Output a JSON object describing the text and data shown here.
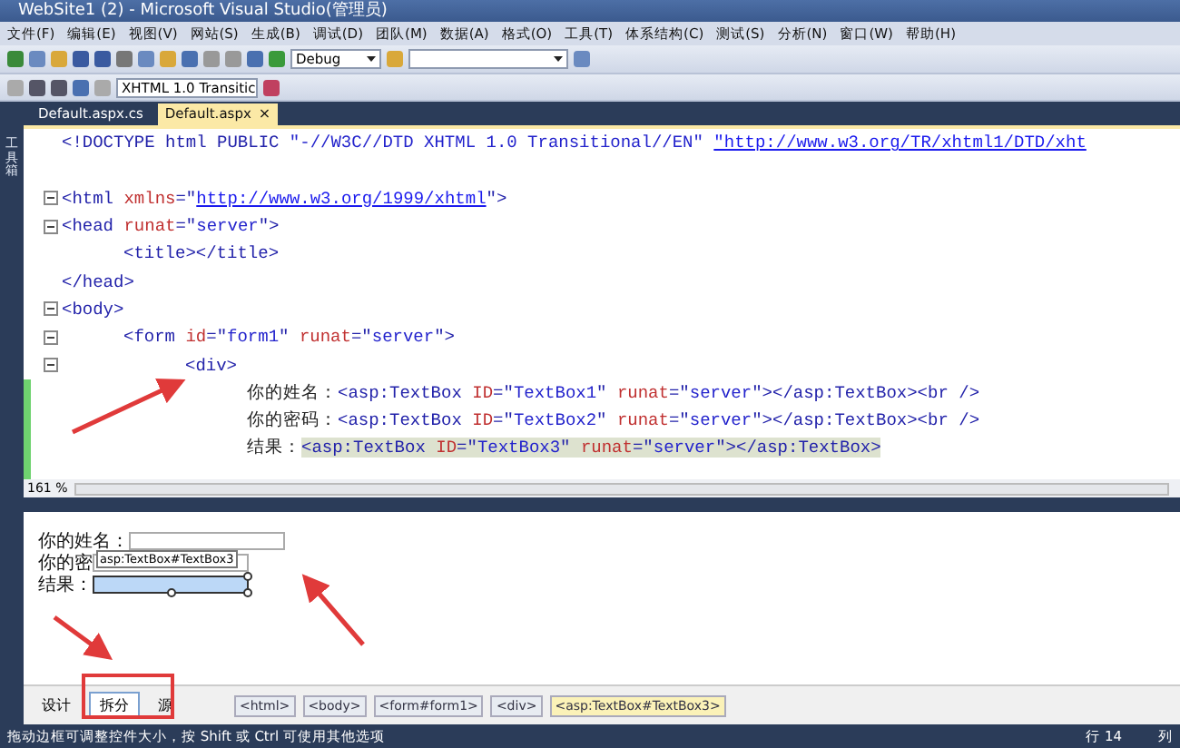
{
  "window": {
    "title": "WebSite1 (2) - Microsoft Visual Studio(管理员)"
  },
  "menu": [
    "文件(F)",
    "编辑(E)",
    "视图(V)",
    "网站(S)",
    "生成(B)",
    "调试(D)",
    "团队(M)",
    "数据(A)",
    "格式(O)",
    "工具(T)",
    "体系结构(C)",
    "测试(S)",
    "分析(N)",
    "窗口(W)",
    "帮助(H)"
  ],
  "toolbar": {
    "configuration": "Debug",
    "doctype": "XHTML 1.0 Transitic"
  },
  "sidebar": {
    "label": "工具箱"
  },
  "tabs": [
    {
      "label": "Default.aspx.cs",
      "selected": false
    },
    {
      "label": "Default.aspx",
      "selected": true,
      "close": "×"
    }
  ],
  "code_lines": [
    {
      "fold": false,
      "changed": false,
      "tokens": [
        {
          "kind": "tag",
          "text": "<!DOCTYPE html PUBLIC "
        },
        {
          "kind": "value",
          "text": "\"-//W3C//DTD XHTML 1.0 Transitional//EN\" "
        },
        {
          "kind": "link",
          "text": "\"http://www.w3.org/TR/xhtml1/DTD/xht"
        }
      ]
    },
    {
      "fold": false,
      "changed": false
    },
    {
      "fold": true,
      "changed": false,
      "tokens": [
        {
          "kind": "tag",
          "text": "<html "
        },
        {
          "kind": "attr",
          "text": "xmlns"
        },
        {
          "kind": "tag",
          "text": "=\""
        },
        {
          "kind": "link",
          "text": "http://www.w3.org/1999/xhtml"
        },
        {
          "kind": "tag",
          "text": "\">"
        }
      ]
    },
    {
      "fold": true,
      "changed": false,
      "tokens": [
        {
          "kind": "tag",
          "text": "<head "
        },
        {
          "kind": "attr",
          "text": "runat"
        },
        {
          "kind": "tag",
          "text": "=\""
        },
        {
          "kind": "value",
          "text": "server"
        },
        {
          "kind": "tag",
          "text": "\">"
        }
      ],
      "children": [
        {
          "fold": false,
          "changed": false,
          "tokens": [
            {
              "kind": "tag",
              "text": "<title></title>"
            }
          ]
        }
      ]
    },
    {
      "fold": false,
      "changed": false,
      "tokens": [
        {
          "kind": "tag",
          "text": "</head>"
        }
      ]
    },
    {
      "fold": true,
      "changed": false,
      "tokens": [
        {
          "kind": "tag",
          "text": "<body>"
        }
      ],
      "children": [
        {
          "fold": true,
          "changed": false,
          "tokens": [
            {
              "kind": "tag",
              "text": "<form "
            },
            {
              "kind": "attr",
              "text": "id"
            },
            {
              "kind": "tag",
              "text": "=\""
            },
            {
              "kind": "value",
              "text": "form1"
            },
            {
              "kind": "tag",
              "text": "\" "
            },
            {
              "kind": "attr",
              "text": "runat"
            },
            {
              "kind": "tag",
              "text": "=\""
            },
            {
              "kind": "value",
              "text": "server"
            },
            {
              "kind": "tag",
              "text": "\">"
            }
          ],
          "children": [
            {
              "fold": true,
              "changed": false,
              "tokens": [
                {
                  "kind": "tag",
                  "text": "<div>"
                }
              ],
              "children": [
                {
                  "fold": false,
                  "changed": true,
                  "tokens": [
                    {
                      "kind": "text",
                      "text": "你的姓名："
                    },
                    {
                      "kind": "tag",
                      "text": "<asp:TextBox "
                    },
                    {
                      "kind": "attr",
                      "text": "ID"
                    },
                    {
                      "kind": "tag",
                      "text": "=\""
                    },
                    {
                      "kind": "value",
                      "text": "TextBox1"
                    },
                    {
                      "kind": "tag",
                      "text": "\" "
                    },
                    {
                      "kind": "attr",
                      "text": "runat"
                    },
                    {
                      "kind": "tag",
                      "text": "=\""
                    },
                    {
                      "kind": "value",
                      "text": "server"
                    },
                    {
                      "kind": "tag",
                      "text": "\"></asp:TextBox><br />"
                    }
                  ]
                },
                {
                  "fold": false,
                  "changed": true,
                  "tokens": [
                    {
                      "kind": "text",
                      "text": "你的密码："
                    },
                    {
                      "kind": "tag",
                      "text": "<asp:TextBox "
                    },
                    {
                      "kind": "attr",
                      "text": "ID"
                    },
                    {
                      "kind": "tag",
                      "text": "=\""
                    },
                    {
                      "kind": "value",
                      "text": "TextBox2"
                    },
                    {
                      "kind": "tag",
                      "text": "\" "
                    },
                    {
                      "kind": "attr",
                      "text": "runat"
                    },
                    {
                      "kind": "tag",
                      "text": "=\""
                    },
                    {
                      "kind": "value",
                      "text": "server"
                    },
                    {
                      "kind": "tag",
                      "text": "\"></asp:TextBox><br />"
                    }
                  ]
                },
                {
                  "fold": false,
                  "changed": true,
                  "tokens": [
                    {
                      "kind": "text",
                      "text": "结果："
                    },
                    {
                      "kind": "tag",
                      "text": "<asp:TextBox ",
                      "hl": true
                    },
                    {
                      "kind": "attr",
                      "text": "ID",
                      "hl": true
                    },
                    {
                      "kind": "tag",
                      "text": "=\"",
                      "hl": true
                    },
                    {
                      "kind": "value",
                      "text": "TextBox3",
                      "hl": true
                    },
                    {
                      "kind": "tag",
                      "text": "\" ",
                      "hl": true
                    },
                    {
                      "kind": "attr",
                      "text": "runat",
                      "hl": true
                    },
                    {
                      "kind": "tag",
                      "text": "=\"",
                      "hl": true
                    },
                    {
                      "kind": "value",
                      "text": "server",
                      "hl": true
                    },
                    {
                      "kind": "tag",
                      "text": "\"></asp:TextBox>",
                      "hl": true
                    }
                  ]
                },
                {
                  "fold": false,
                  "changed": true
                }
              ]
            }
          ]
        }
      ]
    }
  ],
  "zoom": "161 %",
  "design": {
    "rows": [
      {
        "label": "你的姓名：",
        "selected": false
      },
      {
        "label": "你的密",
        "selected": false
      },
      {
        "label": "结果：",
        "selected": true
      }
    ],
    "tooltip": "asp:TextBox#TextBox3"
  },
  "view_tabs": [
    {
      "label": "设计",
      "selected": false
    },
    {
      "label": "拆分",
      "selected": true
    },
    {
      "label": "源",
      "selected": false
    }
  ],
  "breadcrumb": [
    {
      "label": "<html>",
      "selected": false
    },
    {
      "label": "<body>",
      "selected": false
    },
    {
      "label": "<form#form1>",
      "selected": false
    },
    {
      "label": "<div>",
      "selected": false
    },
    {
      "label": "<asp:TextBox#TextBox3>",
      "selected": true
    }
  ],
  "status_bar": {
    "message": "拖动边框可调整控件大小，按 Shift 或 Ctrl 可使用其他选项",
    "line": "行 14",
    "column": "列"
  }
}
